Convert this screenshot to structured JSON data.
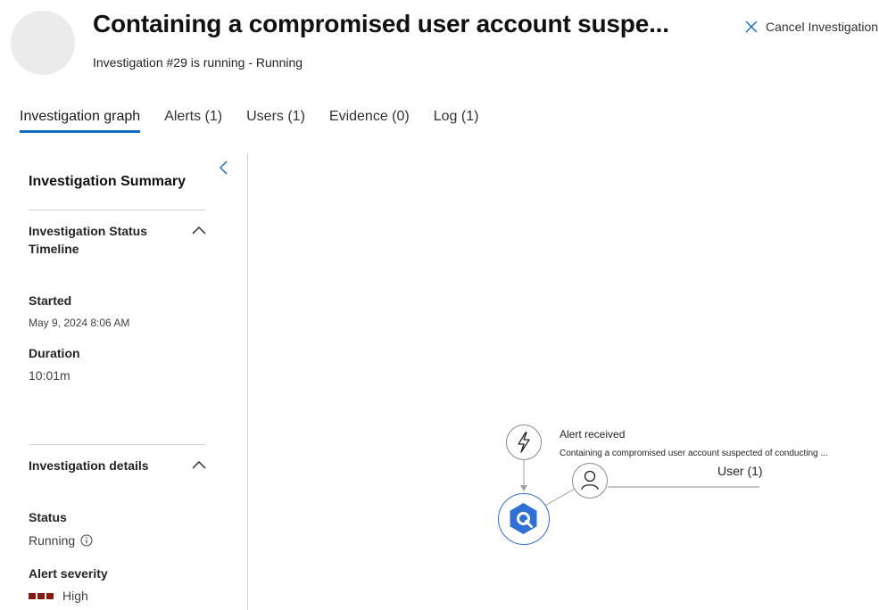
{
  "header": {
    "title": "Containing a compromised user account suspe...",
    "subtitle": "Investigation #29 is running - Running",
    "cancel_label": "Cancel Investigation"
  },
  "tabs": [
    {
      "label": "Investigation graph",
      "active": true
    },
    {
      "label": "Alerts (1)",
      "active": false
    },
    {
      "label": "Users (1)",
      "active": false
    },
    {
      "label": "Evidence (0)",
      "active": false
    },
    {
      "label": "Log (1)",
      "active": false
    }
  ],
  "summary": {
    "title": "Investigation Summary",
    "status_timeline": {
      "heading": "Investigation Status Timeline",
      "started_label": "Started",
      "started_value": "May 9, 2024 8:06 AM",
      "duration_label": "Duration",
      "duration_value": "10:01m"
    },
    "details": {
      "heading": "Investigation details",
      "status_label": "Status",
      "status_value": "Running",
      "severity_label": "Alert severity",
      "severity_value": "High",
      "severity_color": "#8b1a10"
    }
  },
  "graph": {
    "alert_node": {
      "icon": "lightning-icon",
      "title": "Alert received",
      "description": "Containing a compromised user account suspected of conducting ..."
    },
    "investigation_node": {
      "icon": "investigation-hexagon-icon"
    },
    "user_node": {
      "icon": "user-icon",
      "label": "User (1)"
    }
  },
  "colors": {
    "accent": "#0f6cbd",
    "investigation_blue": "#2f6fd6"
  }
}
